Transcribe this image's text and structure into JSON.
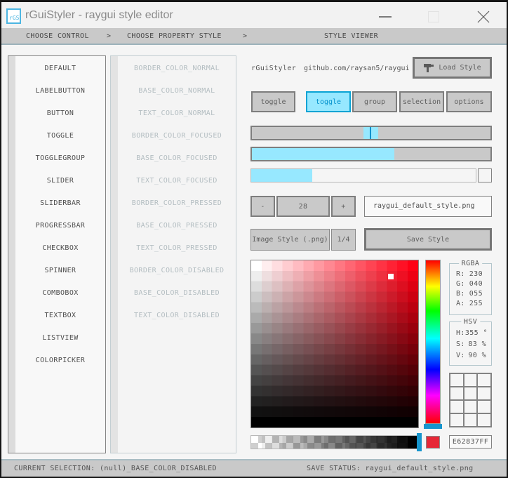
{
  "window": {
    "title": "rGuiStyler - raygui style editor",
    "icon_text": "rGS",
    "accent_color": "#4db6e2"
  },
  "navbar": {
    "section1": "CHOOSE CONTROL",
    "separator1": ">",
    "section2": "CHOOSE PROPERTY STYLE",
    "separator2": ">",
    "section3": "STYLE VIEWER"
  },
  "controls_list": {
    "items": [
      "DEFAULT",
      "LABELBUTTON",
      "BUTTON",
      "TOGGLE",
      "TOGGLEGROUP",
      "SLIDER",
      "SLIDERBAR",
      "PROGRESSBAR",
      "CHECKBOX",
      "SPINNER",
      "COMBOBOX",
      "TEXTBOX",
      "LISTVIEW",
      "COLORPICKER"
    ]
  },
  "properties_list": {
    "items": [
      "BORDER_COLOR_NORMAL",
      "BASE_COLOR_NORMAL",
      "TEXT_COLOR_NORMAL",
      "BORDER_COLOR_FOCUSED",
      "BASE_COLOR_FOCUSED",
      "TEXT_COLOR_FOCUSED",
      "BORDER_COLOR_PRESSED",
      "BASE_COLOR_PRESSED",
      "TEXT_COLOR_PRESSED",
      "BORDER_COLOR_DISABLED",
      "BASE_COLOR_DISABLED",
      "TEXT_COLOR_DISABLED"
    ]
  },
  "viewer": {
    "app_label": "rGuiStyler",
    "repo_label": "github.com/raysan5/raygui",
    "load_button": "Load Style",
    "toggle_single": "toggle",
    "toggle_group": [
      "toggle",
      "group",
      "selection",
      "options"
    ],
    "active_toggle": "toggle",
    "spinner_minus": "-",
    "spinner_value": "28",
    "spinner_plus": "+",
    "filename": "raygui_default_style.png",
    "image_style_button": "Image Style (.png)",
    "quarter_button": "1/4",
    "save_button": "Save Style"
  },
  "picker": {
    "rgba_title": "RGBA",
    "r_label": "R:",
    "r_value": "230",
    "g_label": "G:",
    "g_value": "040",
    "b_label": "B:",
    "b_value": "055",
    "a_label": "A:",
    "a_value": "255",
    "hsv_title": "HSV",
    "h_label": "H:",
    "h_value": "355 °",
    "s_label": "S:",
    "s_value": "83 %",
    "v_label": "V:",
    "v_value": "90 %",
    "hex_value": "E62837FF",
    "current_color": "#e62837"
  },
  "statusbar": {
    "left": "CURRENT SELECTION: (null)_BASE_COLOR_DISABLED",
    "right": "SAVE STATUS: raygui_default_style.png"
  }
}
